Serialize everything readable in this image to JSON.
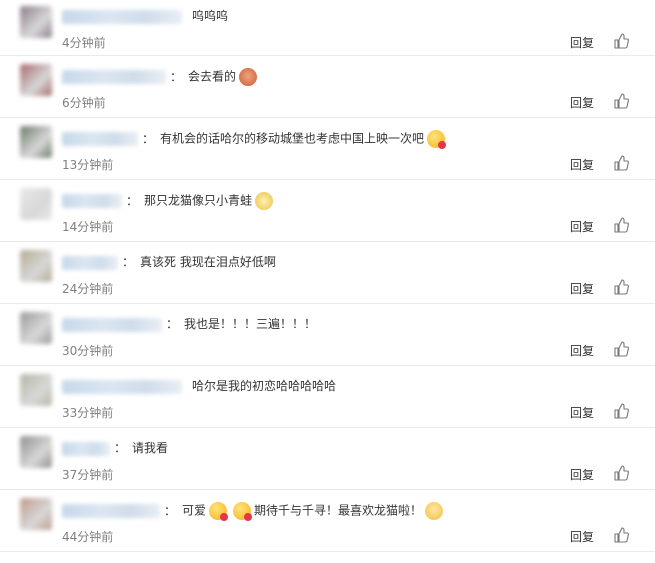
{
  "comments": [
    {
      "avatar_color": "#8b7c8a",
      "nick_width": 120,
      "sep": "",
      "text": "呜呜呜",
      "emojis": [],
      "time": "4分钟前",
      "reply": "回复"
    },
    {
      "avatar_color": "#a56a6a",
      "nick_width": 104,
      "sep": "：",
      "text": "会去看的",
      "emojis": [
        "doge"
      ],
      "time": "6分钟前",
      "reply": "回复"
    },
    {
      "avatar_color": "#6c7a6a",
      "nick_width": 76,
      "sep": "：",
      "text": "有机会的话哈尔的移动城堡也考虑中国上映一次吧",
      "emojis": [
        "kiss"
      ],
      "time": "13分钟前",
      "reply": "回复"
    },
    {
      "avatar_color": "#e8e8e8",
      "nick_width": 60,
      "sep": "：",
      "text": "那只龙猫像只小青蛙",
      "emojis": [
        "frog"
      ],
      "time": "14分钟前",
      "reply": "回复"
    },
    {
      "avatar_color": "#b4ab92",
      "nick_width": 56,
      "sep": "：",
      "text": "真该死 我现在泪点好低啊",
      "emojis": [],
      "time": "24分钟前",
      "reply": "回复"
    },
    {
      "avatar_color": "#9a9a9a",
      "nick_width": 100,
      "sep": "：",
      "text": "我也是！！！三遍！！！",
      "emojis": [],
      "time": "30分钟前",
      "reply": "回复"
    },
    {
      "avatar_color": "#b6b6a6",
      "nick_width": 120,
      "sep": "",
      "text": "哈尔是我的初恋哈哈哈哈哈",
      "emojis": [],
      "time": "33分钟前",
      "reply": "回复"
    },
    {
      "avatar_color": "#8e8e8e",
      "nick_width": 48,
      "sep": "：",
      "text": "请我看",
      "emojis": [],
      "time": "37分钟前",
      "reply": "回复"
    },
    {
      "avatar_color": "#c09a8c",
      "nick_width": 98,
      "sep": "：",
      "text_parts": [
        "可爱",
        "期待千与千寻！最喜欢龙猫啦！"
      ],
      "emojis": [
        "kiss",
        "kiss",
        "sad"
      ],
      "time": "44分钟前",
      "reply": "回复"
    }
  ],
  "icons": {
    "like": "thumbs-up-icon"
  }
}
